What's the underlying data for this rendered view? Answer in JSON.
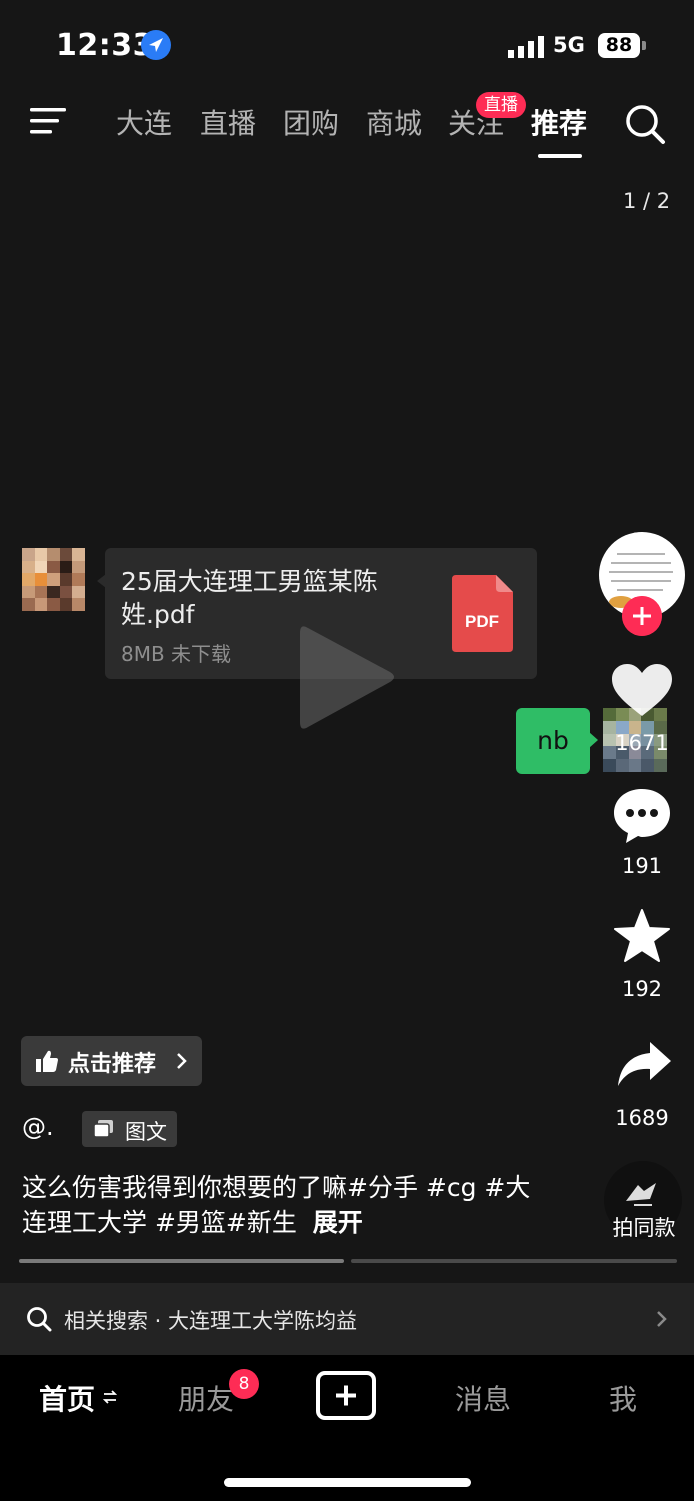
{
  "status_bar": {
    "time": "12:33",
    "network": "5G",
    "battery": "88"
  },
  "top_nav": {
    "tabs": [
      "大连",
      "直播",
      "团购",
      "商城",
      "关注",
      "推荐"
    ],
    "active_tab": "推荐",
    "follow_badge": "直播"
  },
  "page_indicator": "1 / 2",
  "chat": {
    "file_title": "25届大连理工男篮某陈姓.pdf",
    "file_meta": "8MB  未下载",
    "file_type_label": "PDF",
    "reply_text": "nb"
  },
  "rail": {
    "likes": "1671",
    "comments": "191",
    "favorites": "192",
    "shares": "1689"
  },
  "post": {
    "recommend_label": "点击推荐",
    "author": "@.",
    "type_label": "图文",
    "caption": "这么伤害我得到你想要的了嘛#分手 #cg #大连理工大学 #男篮#新生",
    "expand_label": "展开",
    "same_style_label": "拍同款"
  },
  "related_search": "相关搜索 · 大连理工大学陈均益",
  "tabbar": {
    "home": "首页",
    "friends": "朋友",
    "friends_badge": "8",
    "messages": "消息",
    "me": "我"
  },
  "colors": {
    "accent": "#fe2c55",
    "background": "#161616",
    "chat_green": "#2fbd66",
    "pdf_red": "#e54b4b"
  }
}
